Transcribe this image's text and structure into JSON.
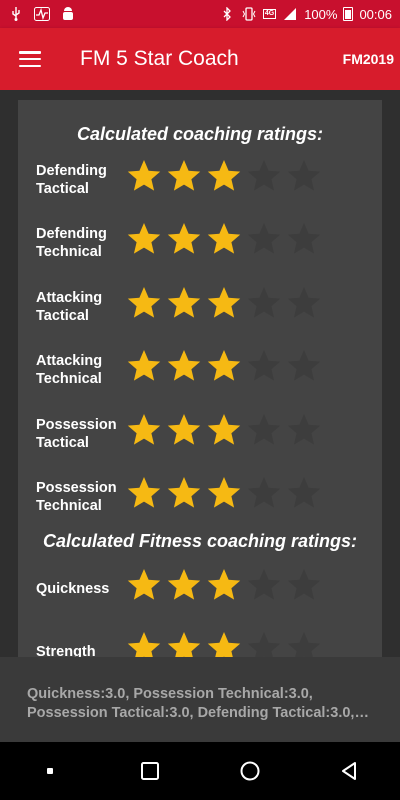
{
  "status_bar": {
    "network": "4G",
    "battery": "100%",
    "time": "00:06"
  },
  "app_bar": {
    "title": "FM 5 Star Coach",
    "badge": "FM2019"
  },
  "coaching": {
    "title": "Calculated coaching ratings:",
    "max_stars": 5,
    "items": [
      {
        "label": "Defending\nTactical",
        "rating": 3
      },
      {
        "label": "Defending\nTechnical",
        "rating": 3
      },
      {
        "label": "Attacking\nTactical",
        "rating": 3
      },
      {
        "label": "Attacking\nTechnical",
        "rating": 3
      },
      {
        "label": "Possession\nTactical",
        "rating": 3
      },
      {
        "label": "Possession\nTechnical",
        "rating": 3
      }
    ]
  },
  "fitness": {
    "title": "Calculated Fitness coaching ratings:",
    "max_stars": 5,
    "items": [
      {
        "label": "Quickness",
        "rating": 3
      },
      {
        "label": "Strength",
        "rating": 3
      }
    ]
  },
  "summary": {
    "line1": "Quickness:3.0, Possession Technical:3.0,",
    "line2": "Possession Tactical:3.0, Defending Tactical:3.0,…"
  },
  "colors": {
    "star_filled": "#f6b913",
    "star_empty": "#3d3d3d",
    "accent": "#d71c2c"
  }
}
